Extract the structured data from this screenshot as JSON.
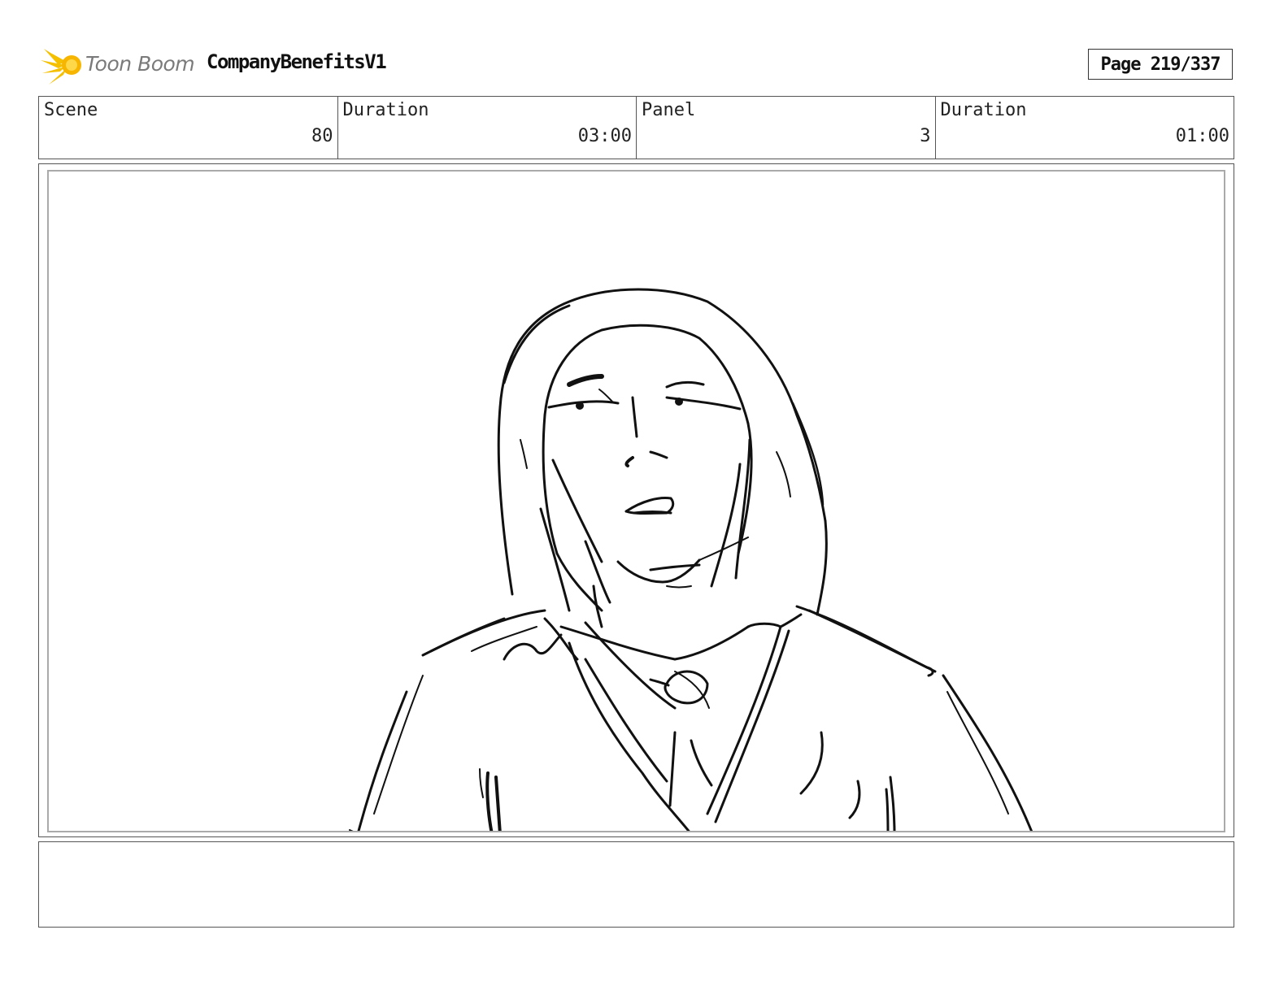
{
  "header": {
    "logo_text": "Toon Boom",
    "project_title": "CompanyBenefitsV1",
    "page_label": "Page 219/337"
  },
  "info": {
    "scene_label": "Scene",
    "scene_value": "80",
    "scene_duration_label": "Duration",
    "scene_duration_value": "03:00",
    "panel_label": "Panel",
    "panel_value": "3",
    "panel_duration_label": "Duration",
    "panel_duration_value": "01:00"
  },
  "notes": {
    "text": ""
  },
  "colors": {
    "logo_flare": "#f5c000",
    "logo_text": "#7a7a7a",
    "border": "#555555",
    "sketch_stroke": "#111111"
  },
  "icons": {
    "logo": "toon-boom-flare-icon"
  }
}
